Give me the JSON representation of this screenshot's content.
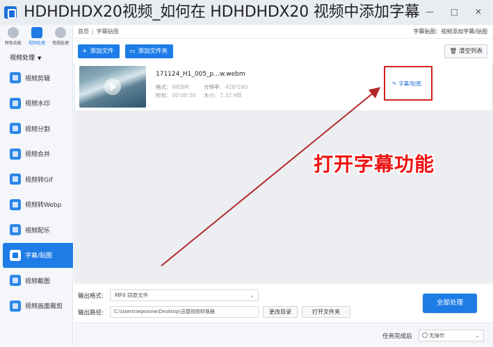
{
  "caption": "HDHDHDX20视频_如何在 HDHDHDX20 视频中添加字幕",
  "window_controls": "— □ ✕",
  "top_icons": [
    {
      "label": "特色功能"
    },
    {
      "label": "视频处理"
    },
    {
      "label": "常规处理"
    }
  ],
  "nav": {
    "header": "视频处理",
    "items": [
      {
        "label": "视频剪辑"
      },
      {
        "label": "视频水印"
      },
      {
        "label": "视频分割"
      },
      {
        "label": "视频合并"
      },
      {
        "label": "视频转Gif"
      },
      {
        "label": "视频转Webp"
      },
      {
        "label": "视频配乐"
      },
      {
        "label": "字幕/贴图"
      },
      {
        "label": "视频截图"
      },
      {
        "label": "视频画面裁剪"
      }
    ]
  },
  "breadcrumb": {
    "home": "首页",
    "current": "字幕贴图",
    "right": "字幕贴图：视频添加字幕/贴图"
  },
  "toolbar": {
    "add_file": "添加文件",
    "add_folder": "添加文件夹",
    "clear_list": "清空列表"
  },
  "file": {
    "name": "171124_H1_005_p...w.webm",
    "format_label": "格式:",
    "format_value": "WEBM",
    "resolution_label": "分辨率:",
    "resolution_value": "426*240",
    "duration_label": "时长:",
    "duration_value": "00:00:30",
    "size_label": "大小:",
    "size_value": "1.32 MB",
    "action": "字幕/贴图"
  },
  "callout": "打开字幕功能",
  "settings": {
    "format_label": "输出格式:",
    "format_value": "MP4  同原文件",
    "path_label": "输出路径:",
    "path_value": "C:\\Users\\wqeaoiw\\Desktop\\迅捷视频转换器",
    "change_dir": "更改目录",
    "open_folder": "打开文件夹",
    "batch": "全部处理"
  },
  "status": {
    "label": "任务完成后",
    "value": "无操作"
  }
}
